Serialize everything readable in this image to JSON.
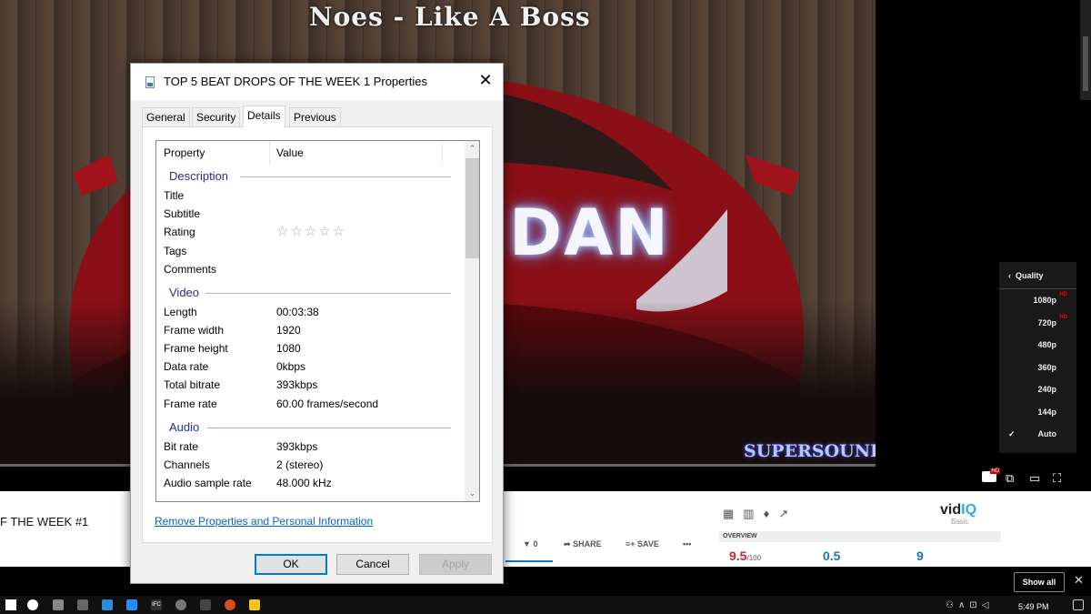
{
  "video": {
    "title": "Noes - Like A Boss",
    "overlay_text": "DAN",
    "watermark": "SUPERSOUND"
  },
  "quality_menu": {
    "title": "Quality",
    "items": [
      {
        "label": "1080p",
        "badge": "HD"
      },
      {
        "label": "720p",
        "badge": "HD"
      },
      {
        "label": "480p",
        "badge": ""
      },
      {
        "label": "360p",
        "badge": ""
      },
      {
        "label": "240p",
        "badge": ""
      },
      {
        "label": "144p",
        "badge": ""
      },
      {
        "label": "Auto",
        "badge": "",
        "selected": true
      }
    ]
  },
  "page": {
    "video_title": "F THE WEEK #1",
    "dislike_count": "0",
    "share_label": "SHARE",
    "save_label": "SAVE",
    "more_label": "•••"
  },
  "vidiq": {
    "logo_vid": "vid",
    "logo_iq": "IQ",
    "plan": "Basic",
    "overview_label": "OVERVIEW",
    "score1": "9.5",
    "score1_suffix": "/100",
    "score2": "0.5",
    "score3": "9",
    "notification_count": "1"
  },
  "downloads_bar": {
    "show_all": "Show all",
    "close": "✕"
  },
  "taskbar": {
    "time": "5:49 PM",
    "ifc_label": "IFC"
  },
  "dialog": {
    "title": "TOP 5 BEAT DROPS OF THE WEEK 1 Properties",
    "close": "✕",
    "tabs": [
      "General",
      "Security",
      "Details",
      "Previous Versions"
    ],
    "active_tab": "Details",
    "columns": {
      "property": "Property",
      "value": "Value"
    },
    "sections": {
      "description": "Description",
      "video": "Video",
      "audio": "Audio"
    },
    "description_rows": [
      {
        "key": "Title",
        "value": ""
      },
      {
        "key": "Subtitle",
        "value": ""
      },
      {
        "key": "Rating",
        "value": "☆☆☆☆☆"
      },
      {
        "key": "Tags",
        "value": ""
      },
      {
        "key": "Comments",
        "value": ""
      }
    ],
    "video_rows": [
      {
        "key": "Length",
        "value": "00:03:38"
      },
      {
        "key": "Frame width",
        "value": "1920"
      },
      {
        "key": "Frame height",
        "value": "1080"
      },
      {
        "key": "Data rate",
        "value": "0kbps"
      },
      {
        "key": "Total bitrate",
        "value": "393kbps"
      },
      {
        "key": "Frame rate",
        "value": "60.00 frames/second"
      }
    ],
    "audio_rows": [
      {
        "key": "Bit rate",
        "value": "393kbps"
      },
      {
        "key": "Channels",
        "value": "2 (stereo)"
      },
      {
        "key": "Audio sample rate",
        "value": "48.000 kHz"
      }
    ],
    "remove_link": "Remove Properties and Personal Information",
    "buttons": {
      "ok": "OK",
      "cancel": "Cancel",
      "apply": "Apply"
    }
  }
}
